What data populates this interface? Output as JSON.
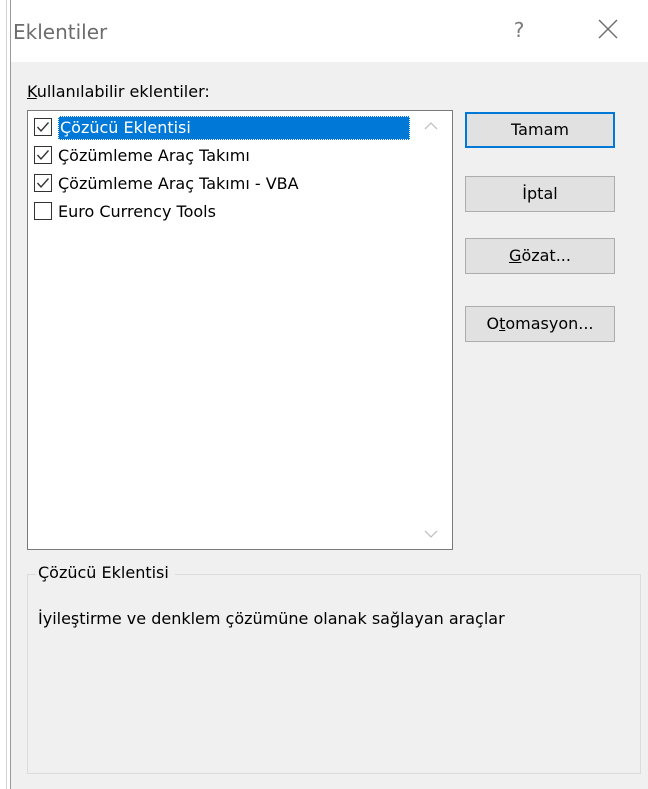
{
  "dialog": {
    "title": "Eklentiler",
    "help_label": "?",
    "close_icon": "close-icon"
  },
  "list": {
    "label_prefix": "K",
    "label_rest": "ullanılabilir eklentiler:",
    "items": [
      {
        "label": "Çözücü Eklentisi",
        "checked": true,
        "selected": true
      },
      {
        "label": "Çözümleme Araç Takımı",
        "checked": true,
        "selected": false
      },
      {
        "label": "Çözümleme Araç Takımı - VBA",
        "checked": true,
        "selected": false
      },
      {
        "label": "Euro Currency Tools",
        "checked": false,
        "selected": false
      }
    ]
  },
  "buttons": {
    "ok": "Tamam",
    "cancel": "İptal",
    "browse_acc": "G",
    "browse_rest": "özat...",
    "automation_pre": "O",
    "automation_acc": "t",
    "automation_rest": "omasyon..."
  },
  "description": {
    "title": "Çözücü Eklentisi",
    "text": "İyileştirme ve denklem çözümüne olanak sağlayan araçlar"
  },
  "colors": {
    "selection": "#0078d7",
    "dialog_bg": "#f0f0f0"
  }
}
